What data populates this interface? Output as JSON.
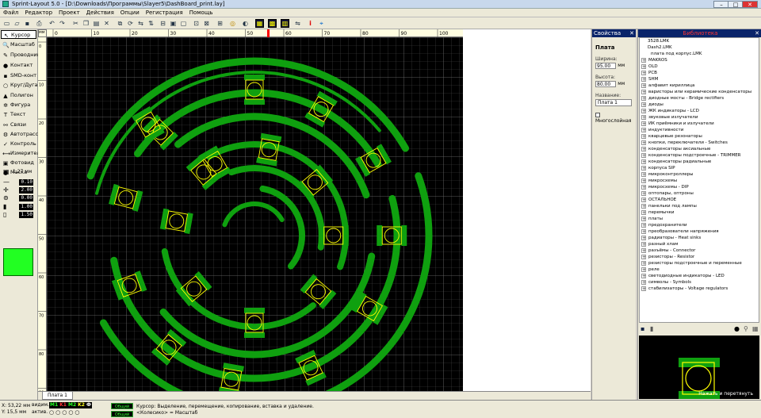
{
  "window": {
    "title": "Sprint-Layout 5.0 - [D:\\Downloads\\Программы\\Slayer5\\DashBoard_print.lay]",
    "btn_min": "–",
    "btn_max": "□",
    "btn_close": "✕"
  },
  "menu": [
    "Файл",
    "Редактор",
    "Проект",
    "Действия",
    "Опции",
    "Регистрация",
    "Помощь"
  ],
  "tools": [
    {
      "label": "Курсор",
      "icon": "↖"
    },
    {
      "label": "Масштаб",
      "icon": "🔍"
    },
    {
      "label": "Проводник",
      "icon": "✎"
    },
    {
      "label": "Контакт",
      "icon": "●"
    },
    {
      "label": "SMD-конт",
      "icon": "▪"
    },
    {
      "label": "Круг/Дуга",
      "icon": "○"
    },
    {
      "label": "Полигон",
      "icon": "▲"
    },
    {
      "label": "Фигура",
      "icon": "✲"
    },
    {
      "label": "Текст",
      "icon": "T"
    },
    {
      "label": "Связи",
      "icon": "⚯"
    },
    {
      "label": "Автотрасса",
      "icon": "⚙"
    },
    {
      "label": "Контроль",
      "icon": "✓"
    },
    {
      "label": "Измеритель",
      "icon": "⟷"
    },
    {
      "label": "Фотовид",
      "icon": "▣"
    },
    {
      "label": "Маска",
      "icon": "●"
    }
  ],
  "grid": {
    "label": "1,27 мм"
  },
  "values": [
    "0.10",
    "2.00",
    "0.00",
    "1.00",
    "1.50"
  ],
  "colors": {
    "accent_green": "#22ff22",
    "board_bg": "#000000",
    "trace": "#0fa00f"
  },
  "rulers": {
    "unit": "мм",
    "top": [
      "0",
      "10",
      "20",
      "30",
      "40",
      "50",
      "60",
      "70",
      "80",
      "90",
      "100"
    ],
    "left": [
      "0",
      "10",
      "20",
      "30",
      "40",
      "50",
      "60",
      "70",
      "80",
      "90"
    ]
  },
  "tab": "Плата 1",
  "properties": {
    "title": "Свойства",
    "close": "✕",
    "section": "Плата",
    "width_label": "Ширина:",
    "width_value": "95.00",
    "height_label": "Высота:",
    "height_value": "80.00",
    "unit": "мм",
    "name_label": "Название:",
    "name_value": "Плата 1",
    "multilayer": "Многослойная"
  },
  "library": {
    "title": "Библиотека",
    "close": "✕",
    "items": [
      {
        "t": "3528.LMK",
        "k": "leaf"
      },
      {
        "t": "Dash2.LMK",
        "k": "leaf"
      },
      {
        "t": "плата под корпус.LMK",
        "k": "leaf2"
      },
      {
        "t": "MAKROS",
        "k": "node"
      },
      {
        "t": "OLD",
        "k": "node"
      },
      {
        "t": "PCB",
        "k": "node"
      },
      {
        "t": "SHM",
        "k": "node"
      },
      {
        "t": "алфавит кириллица",
        "k": "node"
      },
      {
        "t": "варисторы или керамические конденсаторы",
        "k": "node"
      },
      {
        "t": "диодные мосты - Bridge rectifiers",
        "k": "node"
      },
      {
        "t": "диоды",
        "k": "node"
      },
      {
        "t": "ЖК индикаторы - LCD",
        "k": "node"
      },
      {
        "t": "звуковые излучатели",
        "k": "node"
      },
      {
        "t": "ИК приёмники и излучатели",
        "k": "node"
      },
      {
        "t": "индуктивности",
        "k": "node"
      },
      {
        "t": "кварцевые резонаторы",
        "k": "node"
      },
      {
        "t": "кнопки, переключатели - Switches",
        "k": "node"
      },
      {
        "t": "конденсаторы аксиальные",
        "k": "node"
      },
      {
        "t": "конденсаторы подстроечные - TRIMMER",
        "k": "node"
      },
      {
        "t": "конденсаторы радиальные",
        "k": "node"
      },
      {
        "t": "корпуса SIP",
        "k": "node"
      },
      {
        "t": "микроконтроллеры",
        "k": "node"
      },
      {
        "t": "микросхемы",
        "k": "node"
      },
      {
        "t": "микросхемы - DIP",
        "k": "node"
      },
      {
        "t": "оптопары, оптроны",
        "k": "node"
      },
      {
        "t": "ОСТАЛЬНОЕ",
        "k": "node"
      },
      {
        "t": "панельки под лампы",
        "k": "node"
      },
      {
        "t": "перемычки",
        "k": "node"
      },
      {
        "t": "платы",
        "k": "node"
      },
      {
        "t": "предохранители",
        "k": "node"
      },
      {
        "t": "преобразователи напряжения",
        "k": "node"
      },
      {
        "t": "радиаторы - Heat sinks",
        "k": "node"
      },
      {
        "t": "разный хлам",
        "k": "node"
      },
      {
        "t": "разъёмы - Connector",
        "k": "node"
      },
      {
        "t": "резисторы - Resistor",
        "k": "node"
      },
      {
        "t": "резисторы подстроечные и переменные",
        "k": "node"
      },
      {
        "t": "реле",
        "k": "node"
      },
      {
        "t": "светодиодные индикаторы - LED",
        "k": "node"
      },
      {
        "t": "символы - Symbols",
        "k": "node"
      },
      {
        "t": "стабилизаторы - Voltage regulators",
        "k": "node"
      }
    ],
    "preview_caption": "Нажать и перетянуть"
  },
  "status": {
    "x": "X:    53,22 мм",
    "y": "Y:    15,5 мм",
    "vis": "видим.",
    "act": "актив.",
    "layers": [
      {
        "t": "M1",
        "c": "#22ff22"
      },
      {
        "t": "K1",
        "c": "#ff3333"
      },
      {
        "t": "M2",
        "c": "#22ff22"
      },
      {
        "t": "K2",
        "c": "#ffff22"
      },
      {
        "t": "Ф",
        "c": "#ffffff"
      }
    ],
    "box1": "Общий",
    "box2": "Общий",
    "hint1": "Курсор: Выделение, перемещение, копирование, вставка и удаление.",
    "hint2": "<Колесико> = Масштаб"
  }
}
